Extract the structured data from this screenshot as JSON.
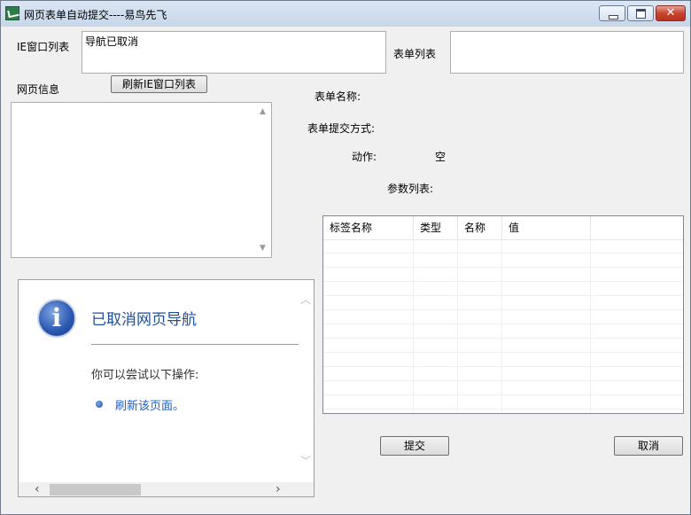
{
  "window": {
    "title": "网页表单自动提交----易鸟先飞",
    "controls": {
      "minimize": "",
      "maximize": "",
      "close": "✕"
    }
  },
  "left": {
    "ie_window_list_label": "IE窗口列表",
    "ie_window_list_value": "导航已取消",
    "refresh_button_label": "刷新IE窗口列表",
    "page_info_label": "网页信息",
    "page_info_value": ""
  },
  "right": {
    "form_list_label": "表单列表",
    "form_list_value": "",
    "form_name_label": "表单名称:",
    "form_submit_method_label": "表单提交方式:",
    "action_label": "动作:",
    "action_value": "空",
    "params_label": "参数列表:"
  },
  "params_table": {
    "columns": [
      "标签名称",
      "类型",
      "名称",
      "值"
    ],
    "rows": []
  },
  "browser": {
    "heading": "已取消网页导航",
    "body_text": "你可以尝试以下操作:",
    "link_text": "刷新该页面。"
  },
  "buttons": {
    "submit": "提交",
    "cancel": "取消"
  },
  "icons": [
    "app-icon",
    "info-icon",
    "bullet-icon",
    "scroll-up-icon",
    "scroll-down-icon",
    "scroll-left-icon",
    "scroll-right-icon"
  ]
}
